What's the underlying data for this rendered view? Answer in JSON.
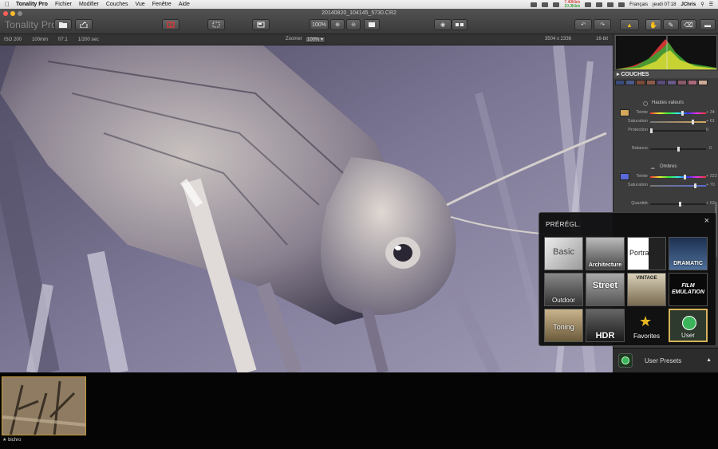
{
  "menubar": {
    "app": "Tonality Pro",
    "menus": [
      "Fichier",
      "Modifier",
      "Couches",
      "Vue",
      "Fenêtre",
      "Aide"
    ],
    "net_up": "7.40Kb/s",
    "net_down": "10.3Kb/s",
    "language": "Français",
    "clock": "jeudi 07:18",
    "user": "JChris"
  },
  "toolbar": {
    "brand": "Tonality Pro",
    "filename": "20140820_104145_5730.CR2",
    "zoom_100": "100%"
  },
  "infobar": {
    "iso": "ISO 200",
    "focal": "100mm",
    "aperture": "f/7.1",
    "shutter": "1/200 sec",
    "zoom_label": "Zoomer",
    "zoom_value": "100%",
    "dimensions": "3504 x 2336",
    "bitdepth": "16-bit"
  },
  "panel": {
    "layers_title": "COUCHES",
    "highlights_title": "Hautes valeurs",
    "shadows_title": "Ombres",
    "highlights": [
      {
        "label": "Teinte",
        "value": "+ 34",
        "pos": 0.58
      },
      {
        "label": "Saturation",
        "value": "+ 61",
        "pos": 0.78
      },
      {
        "label": "Protection",
        "value": "0",
        "pos": 0.0
      }
    ],
    "balance": {
      "label": "Balance",
      "value": "0",
      "pos": 0.5
    },
    "shadows": [
      {
        "label": "Teinte",
        "value": "+ 222",
        "pos": 0.62
      },
      {
        "label": "Saturation",
        "value": "+ 70",
        "pos": 0.82
      }
    ],
    "quantity": {
      "label": "Quantité",
      "value": "+ 53",
      "pos": 0.53
    },
    "swatch_colors": [
      "#3a4a7a",
      "#4a5a8a",
      "#7a4a3a",
      "#8a5a4a",
      "#5a4a7a",
      "#6a5a8a",
      "#8a5a6a",
      "#aa6a7a",
      "#ccaa99"
    ],
    "highlight_color": "#d6a85c",
    "shadow_color": "#5a6ad8"
  },
  "presets": {
    "title": "PRÉRÉGL.",
    "close": "×",
    "items": [
      {
        "label": "Basic",
        "class": "p-basic"
      },
      {
        "label": "Architecture",
        "class": "p-arch"
      },
      {
        "label": "Portrait",
        "class": "p-portrait"
      },
      {
        "label": "DRAMATIC",
        "class": "p-dramatic"
      },
      {
        "label": "Outdoor",
        "class": "p-outdoor"
      },
      {
        "label": "Street",
        "class": "p-street"
      },
      {
        "label": "VINTAGE",
        "class": "p-vintage"
      },
      {
        "label": "FILM EMULATION",
        "class": "p-film"
      },
      {
        "label": "Toning",
        "class": "p-toning"
      },
      {
        "label": "HDR",
        "class": "p-hdr"
      },
      {
        "label": "Favorites",
        "class": "p-fav"
      },
      {
        "label": "User",
        "class": "p-user"
      }
    ]
  },
  "user_presets": {
    "label": "User Presets",
    "arrow": "▲"
  },
  "filmstrip": {
    "items": [
      {
        "label": "bichro"
      }
    ]
  }
}
